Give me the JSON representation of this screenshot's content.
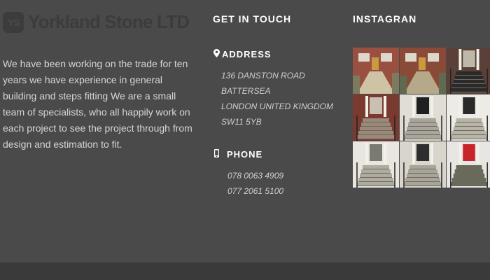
{
  "brand": {
    "icon_text": "YS",
    "name": "Yorkland Stone LTD"
  },
  "about": {
    "text": "We have been working on the trade for ten years we have experience in general building and steps fitting We are a small team of specialists, who all happily work on each project to see the project through from design and estimation to fit."
  },
  "contact": {
    "title": "GET IN TOUCH",
    "address_title": "ADDRESS",
    "address_lines": [
      "136 DANSTON ROAD",
      "BATTERSEA",
      "LONDON UNITED KINGDOM",
      "SW11 5YB"
    ],
    "phone_title": "PHONE",
    "phones": [
      "078 0063 4909",
      "077 2061 5100"
    ]
  },
  "instagram": {
    "title": "INSTAGRAN",
    "photos": [
      {
        "name": "photo-brick-house-path",
        "icon": "house-photo",
        "colors": [
          "#9a5040",
          "#cfc3a5",
          "#7e7a60"
        ]
      },
      {
        "name": "photo-brick-house-garden",
        "icon": "house-photo",
        "colors": [
          "#8a4a38",
          "#b5a98a",
          "#5f6a50"
        ]
      },
      {
        "name": "photo-stone-steps-railings",
        "icon": "steps-photo",
        "colors": [
          "#5a4038",
          "#bdb8a8",
          "#2a2a2a"
        ]
      },
      {
        "name": "photo-brick-steps-door",
        "icon": "steps-photo",
        "colors": [
          "#7a3a30",
          "#c8c0b0",
          "#9a8878"
        ]
      },
      {
        "name": "photo-white-steps-black-door",
        "icon": "steps-photo",
        "colors": [
          "#e0ddd5",
          "#1f1f1f",
          "#aaa59a"
        ]
      },
      {
        "name": "photo-white-porch-steps",
        "icon": "steps-photo",
        "colors": [
          "#ecebe6",
          "#2a2a2a",
          "#b8b4a8"
        ]
      },
      {
        "name": "photo-white-pillars-steps",
        "icon": "steps-photo",
        "colors": [
          "#e8e6df",
          "#7a7a72",
          "#b0ab9f"
        ]
      },
      {
        "name": "photo-grey-steps-railings",
        "icon": "steps-photo",
        "colors": [
          "#d8d5cd",
          "#2e2e2e",
          "#a8a498"
        ]
      },
      {
        "name": "photo-red-door-steps",
        "icon": "steps-photo",
        "colors": [
          "#e7e6e2",
          "#c8242a",
          "#6a6a5a"
        ]
      }
    ]
  }
}
